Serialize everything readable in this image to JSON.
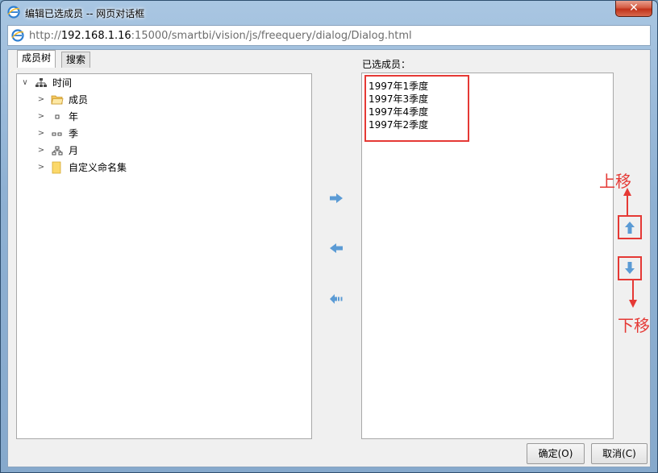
{
  "window": {
    "title": "编辑已选成员 -- 网页对话框",
    "close_label": "✕"
  },
  "address": {
    "prefix": "http://",
    "host": "192.168.1.16",
    "rest": ":15000/smartbi/vision/js/freequery/dialog/Dialog.html"
  },
  "tabs": [
    {
      "label": "成员树"
    },
    {
      "label": "搜索"
    }
  ],
  "tree": {
    "root": {
      "label": "时间",
      "icon": "hierarchy-icon",
      "toggle": "∨"
    },
    "children": [
      {
        "label": "成员",
        "icon": "folder-open-icon",
        "toggle": ">"
      },
      {
        "label": "年",
        "icon": "level-dot-icon",
        "toggle": ">"
      },
      {
        "label": "季",
        "icon": "level-twodots-icon",
        "toggle": ">"
      },
      {
        "label": "月",
        "icon": "hierarchy-small-icon",
        "toggle": ">"
      },
      {
        "label": "自定义命名集",
        "icon": "folder-icon",
        "toggle": ">"
      }
    ]
  },
  "selected": {
    "label": "已选成员：",
    "items": [
      "1997年1季度",
      "1997年3季度",
      "1997年4季度",
      "1997年2季度"
    ]
  },
  "annotations": {
    "up": "上移",
    "down": "下移"
  },
  "buttons": {
    "ok": "确定(O)",
    "cancel": "取消(C)"
  },
  "colors": {
    "accent": "#5b9bd5",
    "annotation": "#e53935"
  }
}
